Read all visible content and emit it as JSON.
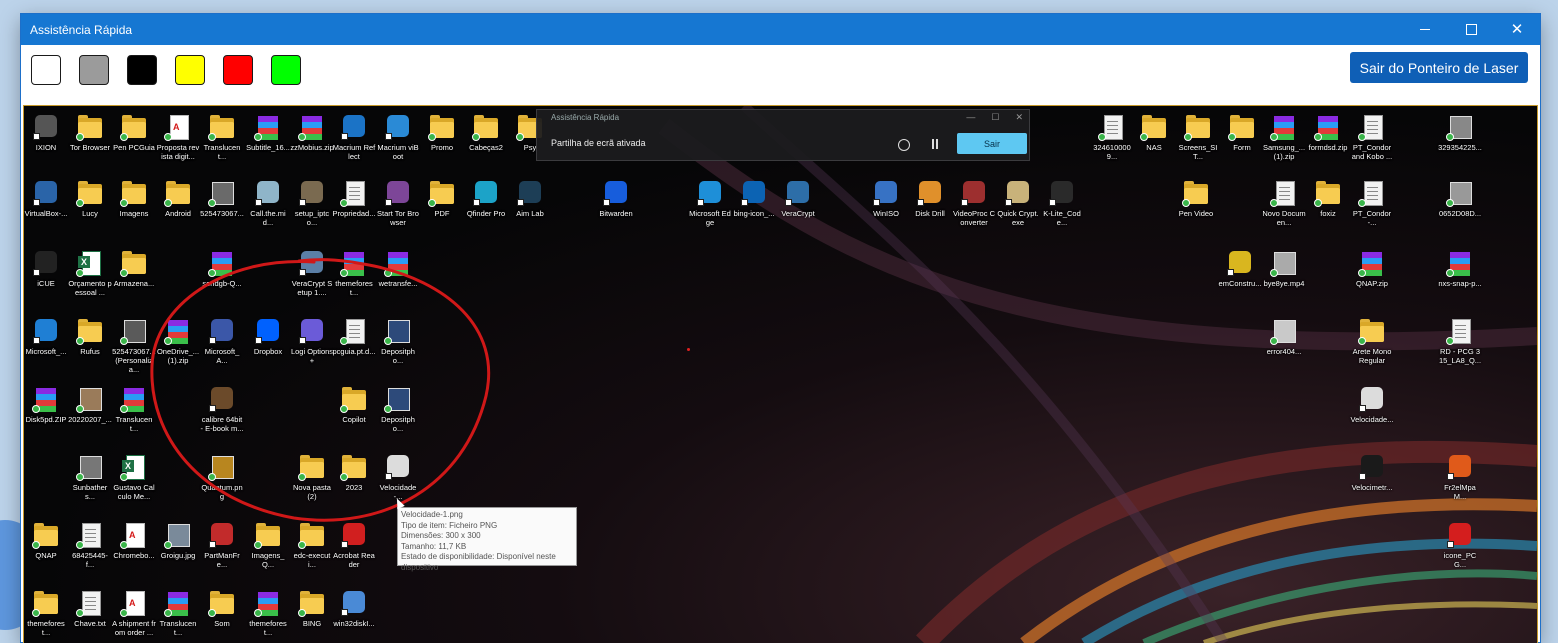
{
  "window": {
    "title": "Assistência Rápida"
  },
  "toolbar": {
    "colors": [
      "#ffffff",
      "#9b9b9b",
      "#000000",
      "#ffff00",
      "#ff0000",
      "#00ff00"
    ],
    "exit_laser_label": "Sair do Ponteiro de Laser"
  },
  "share_panel": {
    "title": "Assistência Rápida",
    "message": "Partilha de ecrã ativada",
    "exit_label": "Sair"
  },
  "tooltip": {
    "lines": [
      "Velocidade-1.png",
      "Tipo de item: Ficheiro PNG",
      "Dimensões: 300 x 300",
      "Tamanho: 11,7 KB",
      "Estado de disponibilidade: Disponível neste dispositivo"
    ]
  },
  "desktop_icons": [
    {
      "label": "IXION",
      "kind": "app",
      "color": "#555555"
    },
    {
      "label": "Tor Browser",
      "kind": "folder"
    },
    {
      "label": "Pen PCGuia",
      "kind": "folder"
    },
    {
      "label": "Proposta revista digit...",
      "kind": "pdf"
    },
    {
      "label": "Translucent...",
      "kind": "folder"
    },
    {
      "label": "Subtitle_16...",
      "kind": "rar"
    },
    {
      "label": "zzMobius.zip",
      "kind": "rar"
    },
    {
      "label": "Macrium Reflect",
      "kind": "app",
      "color": "#1b73c6"
    },
    {
      "label": "Macrium viBoot",
      "kind": "app",
      "color": "#2a8ad6"
    },
    {
      "label": "Promo",
      "kind": "folder"
    },
    {
      "label": "Cabeças2",
      "kind": "folder"
    },
    {
      "label": "Psy",
      "kind": "folder"
    },
    {
      "label": "3246100009...",
      "kind": "doc"
    },
    {
      "label": "NAS",
      "kind": "folder"
    },
    {
      "label": "Screens_SIT...",
      "kind": "folder"
    },
    {
      "label": "Form",
      "kind": "folder"
    },
    {
      "label": "Samsung_... (1).zip",
      "kind": "rar"
    },
    {
      "label": "formdsd.zip",
      "kind": "rar"
    },
    {
      "label": "PT_Condor and Kobo ...",
      "kind": "doc"
    },
    {
      "label": "329354225...",
      "kind": "img",
      "color": "#888888"
    },
    {
      "label": "VirtualBox-...",
      "kind": "app",
      "color": "#2a64a8"
    },
    {
      "label": "Lucy",
      "kind": "folder"
    },
    {
      "label": "Imagens",
      "kind": "folder"
    },
    {
      "label": "Android",
      "kind": "folder"
    },
    {
      "label": "525473067...",
      "kind": "img",
      "color": "#6a6a6a"
    },
    {
      "label": "Call.the.mid...",
      "kind": "app",
      "color": "#8fb5c9"
    },
    {
      "label": "setup_iptco...",
      "kind": "app",
      "color": "#7a6a50"
    },
    {
      "label": "Propriedad...",
      "kind": "doc"
    },
    {
      "label": "Start Tor Browser",
      "kind": "app",
      "color": "#7d4698"
    },
    {
      "label": "PDF",
      "kind": "folder"
    },
    {
      "label": "Qfinder Pro",
      "kind": "app",
      "color": "#1ca3c8"
    },
    {
      "label": "Aim Lab",
      "kind": "app",
      "color": "#1d3e56"
    },
    {
      "label": "Bitwarden",
      "kind": "app",
      "color": "#175ddc"
    },
    {
      "label": "Microsoft Edge",
      "kind": "app",
      "color": "#1e8fd8"
    },
    {
      "label": "bing-icon_...",
      "kind": "app",
      "color": "#0c63b3"
    },
    {
      "label": "VeraCrypt",
      "kind": "app",
      "color": "#2d6ea8"
    },
    {
      "label": "WinISO",
      "kind": "app",
      "color": "#3772c4"
    },
    {
      "label": "Disk Drill",
      "kind": "app",
      "color": "#e0902b"
    },
    {
      "label": "VideoProc Converter",
      "kind": "app",
      "color": "#9d2f2f"
    },
    {
      "label": "Quick Crypt.exe",
      "kind": "app",
      "color": "#c8b27a"
    },
    {
      "label": "K-Lite_Code...",
      "kind": "app",
      "color": "#2a2a2a"
    },
    {
      "label": "Pen Video",
      "kind": "folder"
    },
    {
      "label": "Novo Documen...",
      "kind": "doc"
    },
    {
      "label": "foxiz",
      "kind": "folder"
    },
    {
      "label": "PT_Condor-...",
      "kind": "doc"
    },
    {
      "label": "0652D08D...",
      "kind": "img",
      "color": "#999999"
    },
    {
      "label": "iCUE",
      "kind": "app",
      "color": "#222222"
    },
    {
      "label": "Orçamento pessoal ...",
      "kind": "xls"
    },
    {
      "label": "Armazena...",
      "kind": "folder"
    },
    {
      "label": "sendgb-Q...",
      "kind": "rar"
    },
    {
      "label": "VeraCrypt Setup 1....",
      "kind": "app",
      "color": "#5b7fa6"
    },
    {
      "label": "themeforest...",
      "kind": "rar"
    },
    {
      "label": "wetransfe...",
      "kind": "rar"
    },
    {
      "label": "emConstru...",
      "kind": "app",
      "color": "#d9b61f"
    },
    {
      "label": "bye8ye.mp4",
      "kind": "img",
      "color": "#aaaaaa"
    },
    {
      "label": "QNAP.zip",
      "kind": "rar"
    },
    {
      "label": "nxs-snap-p...",
      "kind": "rar"
    },
    {
      "label": "Microsoft_...",
      "kind": "app",
      "color": "#1f7fd4"
    },
    {
      "label": "Rufus",
      "kind": "folder"
    },
    {
      "label": "525473067... (Personaliza...",
      "kind": "img",
      "color": "#5a5a5a"
    },
    {
      "label": "OneDrive_... (1).zip",
      "kind": "rar"
    },
    {
      "label": "Microsoft_A...",
      "kind": "app",
      "color": "#3b57a8"
    },
    {
      "label": "Dropbox",
      "kind": "app",
      "color": "#0061fe"
    },
    {
      "label": "Logi Options+",
      "kind": "app",
      "color": "#6b5bd8"
    },
    {
      "label": "pcguia.pt.d...",
      "kind": "doc"
    },
    {
      "label": "Depositpho...",
      "kind": "img",
      "color": "#2d4a7a"
    },
    {
      "label": "error404...",
      "kind": "img",
      "color": "#c9c9c9"
    },
    {
      "label": "Arete Mono Regular",
      "kind": "folder"
    },
    {
      "label": "RD - PCG 315_LA8_Q...",
      "kind": "doc"
    },
    {
      "label": "Disk5pd.ZIP",
      "kind": "rar"
    },
    {
      "label": "20220207_...",
      "kind": "img",
      "color": "#9a7b5a"
    },
    {
      "label": "Translucent...",
      "kind": "rar"
    },
    {
      "label": "calibre 64bit - E-book m...",
      "kind": "app",
      "color": "#6b4a2a"
    },
    {
      "label": "Copilot",
      "kind": "folder"
    },
    {
      "label": "Depositpho...",
      "kind": "img",
      "color": "#2d4a7a"
    },
    {
      "label": "Velocidade...",
      "kind": "app",
      "color": "#dcdcdc"
    },
    {
      "label": "Sunbathers...",
      "kind": "img",
      "color": "#777777"
    },
    {
      "label": "Gustavo Calculo Me...",
      "kind": "xls"
    },
    {
      "label": "Quantum.png",
      "kind": "img",
      "color": "#b8861f"
    },
    {
      "label": "Nova pasta (2)",
      "kind": "folder"
    },
    {
      "label": "2023",
      "kind": "folder"
    },
    {
      "label": "Velocidade-...",
      "kind": "app",
      "color": "#dcdcdc"
    },
    {
      "label": "Velocimetr...",
      "kind": "app",
      "color": "#1a1a1a"
    },
    {
      "label": "Fr2elMpaM...",
      "kind": "app",
      "color": "#e05a1a"
    },
    {
      "label": "QNAP",
      "kind": "folder"
    },
    {
      "label": "68425445-f...",
      "kind": "doc"
    },
    {
      "label": "Chromebo...",
      "kind": "pdf"
    },
    {
      "label": "Groigu.jpg",
      "kind": "img",
      "color": "#7a8a9a"
    },
    {
      "label": "PartManFre...",
      "kind": "app",
      "color": "#c22b2b"
    },
    {
      "label": "Imagens_Q...",
      "kind": "folder"
    },
    {
      "label": "edc-executi...",
      "kind": "folder"
    },
    {
      "label": "Acrobat Reader",
      "kind": "app",
      "color": "#d11f1f"
    },
    {
      "label": "icone_PCG...",
      "kind": "app",
      "color": "#d41e1e"
    },
    {
      "label": "themeforest...",
      "kind": "folder"
    },
    {
      "label": "Chave.txt",
      "kind": "doc"
    },
    {
      "label": "A shipment from order ...",
      "kind": "pdf"
    },
    {
      "label": "Translucent...",
      "kind": "rar"
    },
    {
      "label": "Som",
      "kind": "folder"
    },
    {
      "label": "themeforest...",
      "kind": "rar"
    },
    {
      "label": "BING",
      "kind": "folder"
    },
    {
      "label": "win32diskI...",
      "kind": "app",
      "color": "#4a8ad6"
    }
  ]
}
